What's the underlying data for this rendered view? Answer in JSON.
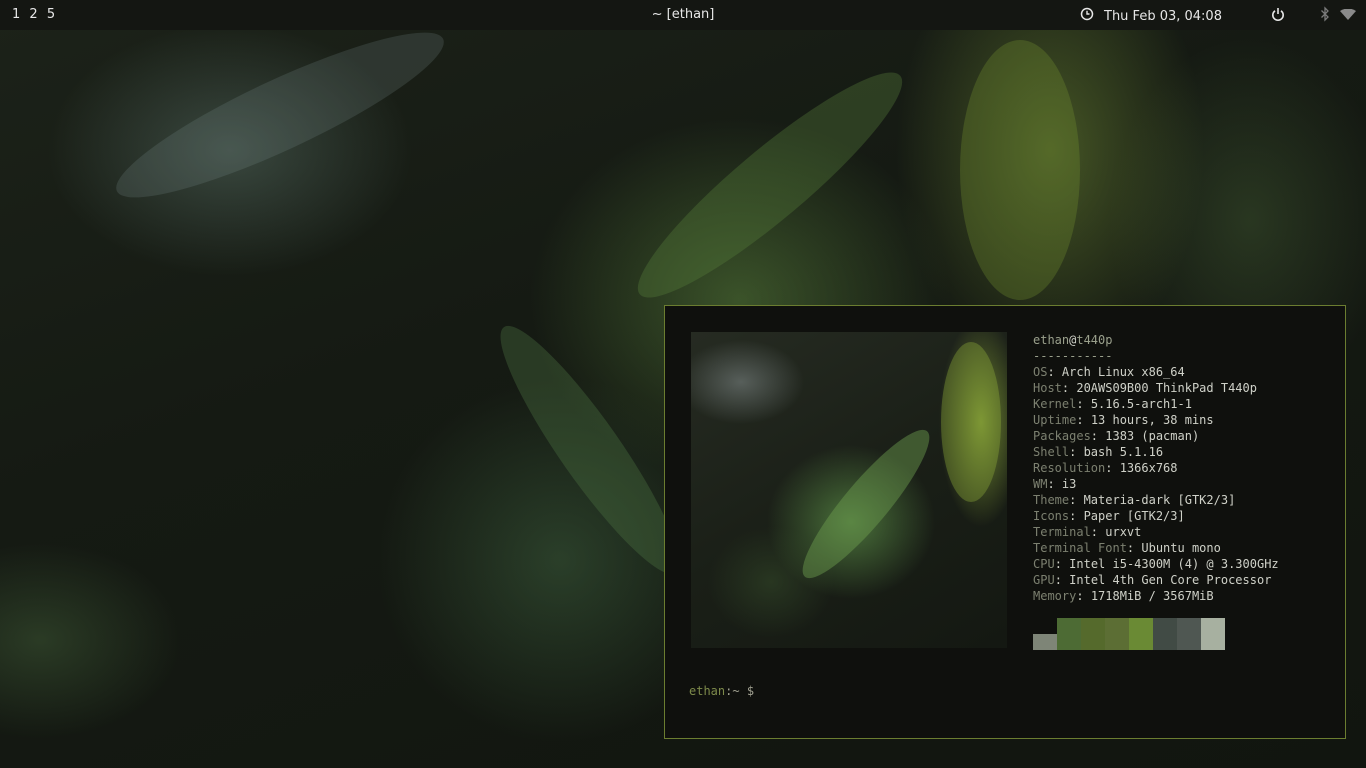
{
  "topbar": {
    "workspaces": [
      "1",
      "2",
      "5"
    ],
    "window_title": "~ [ethan]",
    "datetime": "Thu Feb 03, 04:08",
    "icons": {
      "clock": "clock-icon",
      "power": "power-icon",
      "bluetooth": "bluetooth-icon",
      "wifi": "wifi-icon"
    }
  },
  "terminal": {
    "user": "ethan",
    "at": "@",
    "host": "t440p",
    "separator": "-----------",
    "info": [
      {
        "key": "OS",
        "value": "Arch Linux x86_64"
      },
      {
        "key": "Host",
        "value": "20AWS09B00 ThinkPad T440p"
      },
      {
        "key": "Kernel",
        "value": "5.16.5-arch1-1"
      },
      {
        "key": "Uptime",
        "value": "13 hours, 38 mins"
      },
      {
        "key": "Packages",
        "value": "1383 (pacman)"
      },
      {
        "key": "Shell",
        "value": "bash 5.1.16"
      },
      {
        "key": "Resolution",
        "value": "1366x768"
      },
      {
        "key": "WM",
        "value": "i3"
      },
      {
        "key": "Theme",
        "value": "Materia-dark [GTK2/3]"
      },
      {
        "key": "Icons",
        "value": "Paper [GTK2/3]"
      },
      {
        "key": "Terminal",
        "value": "urxvt"
      },
      {
        "key": "Terminal Font",
        "value": "Ubuntu mono"
      },
      {
        "key": "CPU",
        "value": "Intel i5-4300M (4) @ 3.300GHz"
      },
      {
        "key": "GPU",
        "value": "Intel 4th Gen Core Processor"
      },
      {
        "key": "Memory",
        "value": "1718MiB / 3567MiB"
      }
    ],
    "key_separator": ": ",
    "palette": [
      "#7e8577",
      "#4d6b34",
      "#556a2c",
      "#5c6e34",
      "#6a8a34",
      "#414b45",
      "#4f5752",
      "#a7b0a0"
    ],
    "prompt": {
      "user": "ethan",
      "path": ":~ ",
      "symbol": "$"
    }
  },
  "colors": {
    "accent_border": "#6b7d30",
    "bar_background": "#141612"
  }
}
